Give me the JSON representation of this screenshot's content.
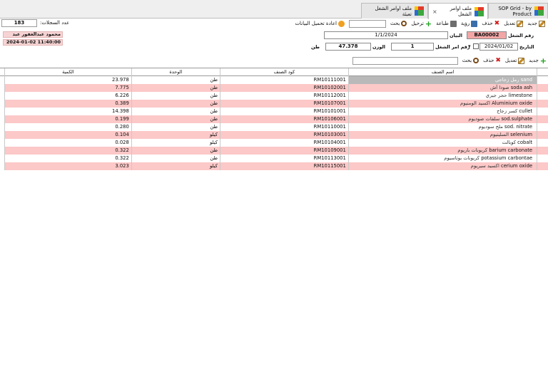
{
  "tabs": [
    {
      "label": "SOP Grid - by Product",
      "active": false
    },
    {
      "label": "ملف اوامر الشغل",
      "active": true
    },
    {
      "label": "ملف اوامر الشغل تعبئة",
      "active": false
    }
  ],
  "tab_close": "×",
  "toolbar": {
    "new": "جديد",
    "edit": "تعديل",
    "delete": "حذف",
    "view": "رؤية",
    "print": "طباعة",
    "post": "ترحيل",
    "search": "بحث",
    "reload": "اعادة تحميل البيانات",
    "record_count_label": "عدد السجلات:",
    "record_count": "183"
  },
  "user": {
    "name": "محمود عبدالغفور عبد",
    "time": "2024-01-02 11:40:00"
  },
  "form": {
    "order_no_label": "رقم الشغل",
    "order_no": "BA00002",
    "statement_label": "البيان",
    "statement": "1/1/2024",
    "date_label": "التاريخ",
    "date": "2024/01/02",
    "work_order_label": "رقم امر الشغل",
    "work_order": "1",
    "weight_label": "الوزن",
    "weight": "47.378",
    "unit": "طن"
  },
  "subbar": {
    "new": "جديد",
    "edit": "تعديل",
    "delete": "حذف",
    "search": "بحث"
  },
  "table": {
    "headers": {
      "name": "اسم الصنف",
      "code": "كود الصنف",
      "unit": "الوحدة",
      "qty": "الكمية"
    },
    "rows": [
      {
        "ar": "رمل زجاجي",
        "en": "sand",
        "code": "RM10111001",
        "unit": "طن",
        "qty": "23.978"
      },
      {
        "ar": "صودا آش",
        "en": "soda ash",
        "code": "RM10102001",
        "unit": "طن",
        "qty": "7.775"
      },
      {
        "ar": "حجر جيري",
        "en": "limestone",
        "code": "RM10112001",
        "unit": "طن",
        "qty": "6.226"
      },
      {
        "ar": "اكسيد الومنيوم",
        "en": "Aluminium oxide",
        "code": "RM10107001",
        "unit": "طن",
        "qty": "0.389"
      },
      {
        "ar": "كسر زجاج",
        "en": "cullet",
        "code": "RM10101001",
        "unit": "طن",
        "qty": "14.398"
      },
      {
        "ar": "سلفات صوديوم",
        "en": "sod.sulphate",
        "code": "RM10106001",
        "unit": "طن",
        "qty": "0.199"
      },
      {
        "ar": "ملح سوديوم",
        "en": "sod. nitrate",
        "code": "RM10110001",
        "unit": "طن",
        "qty": "0.280"
      },
      {
        "ar": "السلينيوم",
        "en": "selenium",
        "code": "RM10103001",
        "unit": "كيلو",
        "qty": "0.104"
      },
      {
        "ar": "كوبالت",
        "en": "cobalt",
        "code": "RM10104001",
        "unit": "كيلو",
        "qty": "0.028"
      },
      {
        "ar": "كربونات باريوم",
        "en": "barium carbonate",
        "code": "RM10109001",
        "unit": "طن",
        "qty": "0.322"
      },
      {
        "ar": "كربونات بوتاسيوم",
        "en": "potassium carbontae",
        "code": "RM10113001",
        "unit": "طن",
        "qty": "0.322"
      },
      {
        "ar": "اكسيد سيريوم",
        "en": "cerium oxide",
        "code": "RM10115001",
        "unit": "كيلو",
        "qty": "3.023"
      }
    ]
  },
  "colors": {
    "pink_row": "#fcc8c8",
    "key_field": "#f3a6a6",
    "selected": "#b9b9b9"
  }
}
